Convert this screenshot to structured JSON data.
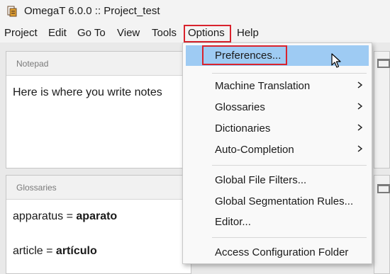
{
  "window": {
    "title": "OmegaT 6.0.0 :: Project_test",
    "icon": "omegat-app-icon"
  },
  "menubar": {
    "items": [
      "Project",
      "Edit",
      "Go To",
      "View",
      "Tools",
      "Options",
      "Help"
    ],
    "active": "Options"
  },
  "notepad": {
    "title": "Notepad",
    "text": "Here is where you write notes"
  },
  "glossaries": {
    "title": "Glossaries",
    "entries": [
      {
        "term": "apparatus",
        "separator": " = ",
        "translation": "aparato"
      },
      {
        "term": "article",
        "separator": " = ",
        "translation": "artículo"
      }
    ]
  },
  "options_menu": {
    "items": [
      {
        "label": "Preferences...",
        "submenu": false,
        "selected": true
      },
      {
        "label": "Machine Translation",
        "submenu": true
      },
      {
        "label": "Glossaries",
        "submenu": true
      },
      {
        "label": "Dictionaries",
        "submenu": true
      },
      {
        "label": "Auto-Completion",
        "submenu": true
      },
      {
        "label": "Global File Filters...",
        "submenu": false
      },
      {
        "label": "Global Segmentation Rules...",
        "submenu": false
      },
      {
        "label": "Editor...",
        "submenu": false
      },
      {
        "label": "Access Configuration Folder",
        "submenu": false
      }
    ]
  },
  "colors": {
    "highlight_border": "#d9232d",
    "selection": "#9ecbf3"
  }
}
